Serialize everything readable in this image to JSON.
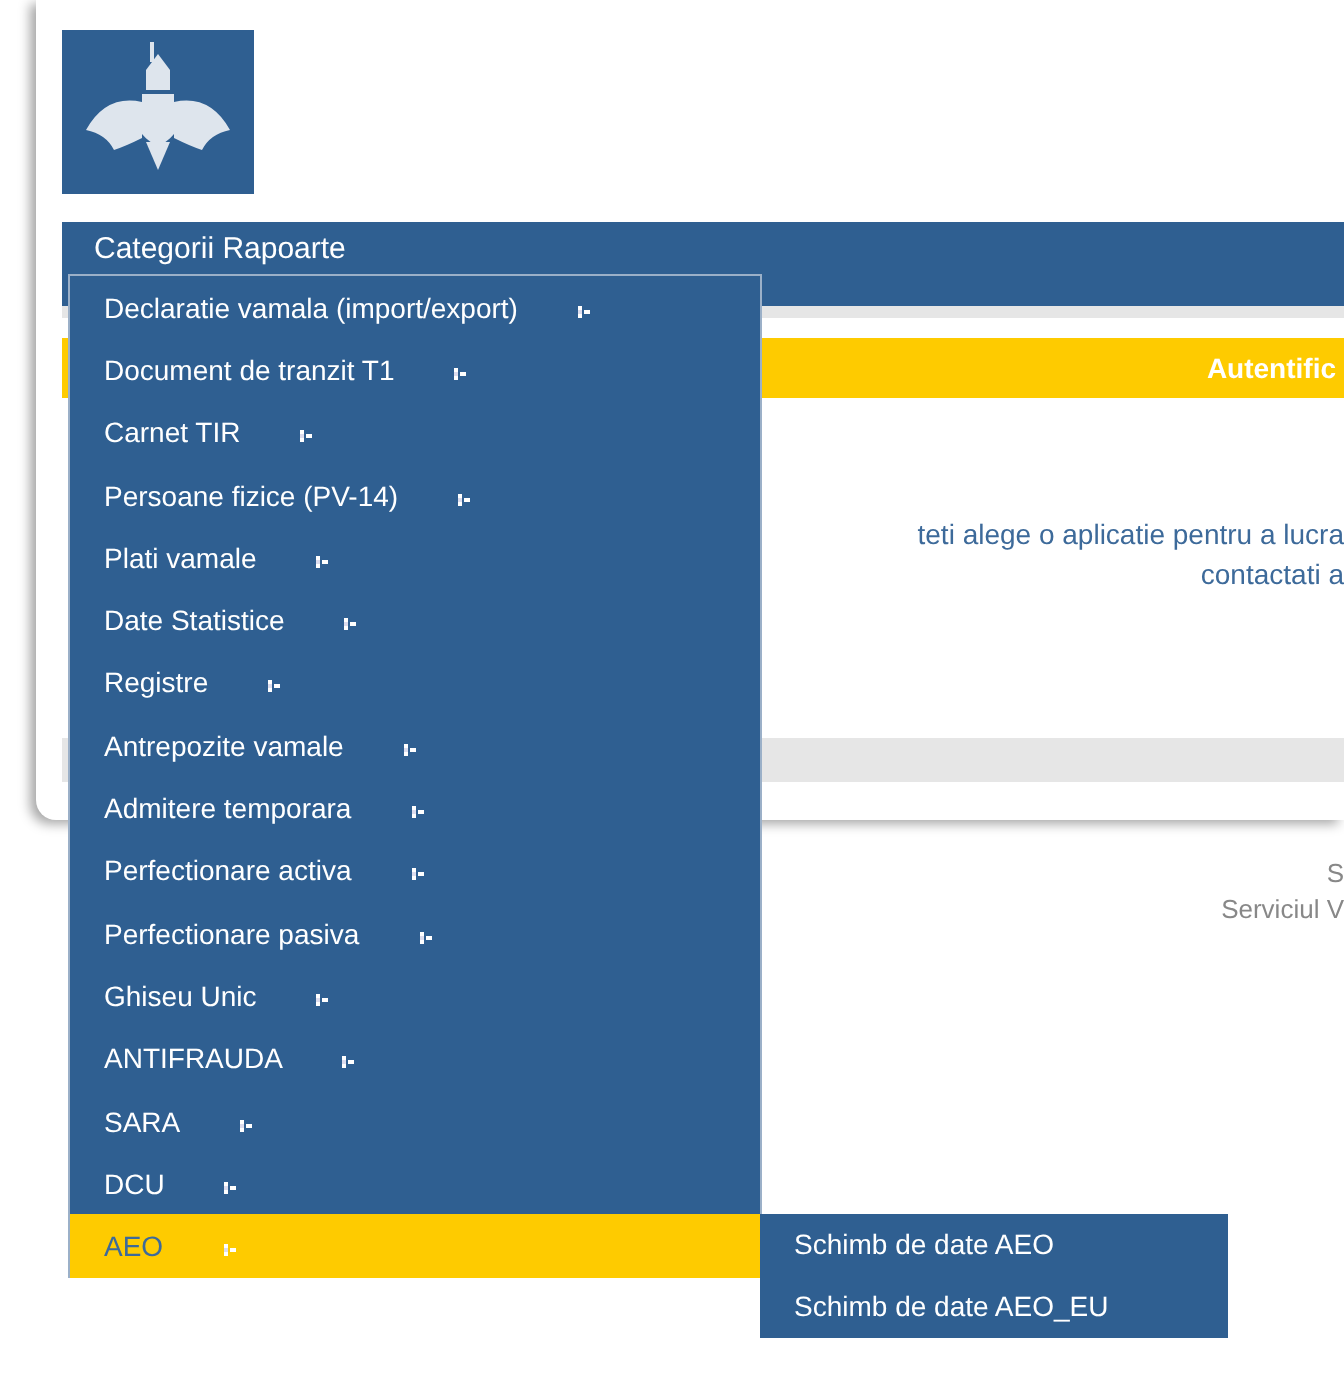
{
  "header": {
    "title": "Categorii Rapoarte"
  },
  "login_bar": {
    "title": "Autentific"
  },
  "message": {
    "lines": [
      "teti alege o aplicatie pentru a lucra",
      "contactati a"
    ]
  },
  "footer": {
    "lines": [
      "S",
      "Serviciul V"
    ]
  },
  "menu": {
    "items": [
      {
        "label": "Declaratie vamala (import/export)",
        "selected": false
      },
      {
        "label": "Document de tranzit T1",
        "selected": false
      },
      {
        "label": "Carnet TIR",
        "selected": false
      },
      {
        "label": "Persoane fizice (PV-14)",
        "selected": false
      },
      {
        "label": "Plati vamale",
        "selected": false
      },
      {
        "label": "Date Statistice",
        "selected": false
      },
      {
        "label": "Registre",
        "selected": false
      },
      {
        "label": "Antrepozite vamale",
        "selected": false
      },
      {
        "label": "Admitere temporara",
        "selected": false
      },
      {
        "label": "Perfectionare activa",
        "selected": false
      },
      {
        "label": "Perfectionare pasiva",
        "selected": false
      },
      {
        "label": "Ghiseu Unic",
        "selected": false
      },
      {
        "label": "ANTIFRAUDA",
        "selected": false
      },
      {
        "label": "SARA",
        "selected": false
      },
      {
        "label": "DCU",
        "selected": false
      },
      {
        "label": "AEO",
        "selected": true
      }
    ]
  },
  "submenu": {
    "items": [
      {
        "label": "Schimb de date AEO"
      },
      {
        "label": "Schimb de date AEO_EU"
      }
    ]
  }
}
